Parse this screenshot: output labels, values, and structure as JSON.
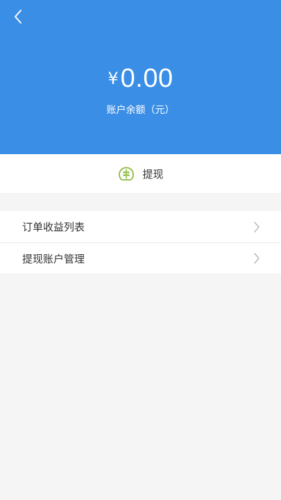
{
  "header": {
    "back_icon": "chevron-left-icon",
    "currency_symbol": "¥",
    "balance": "0.00",
    "balance_label": "账户余额（元）",
    "background_color": "#3a8ee6"
  },
  "withdraw": {
    "label": "提现",
    "icon": "wheat-coin-icon",
    "icon_color": "#8dbb3f"
  },
  "menu": {
    "items": [
      {
        "label": "订单收益列表",
        "icon": "chevron-right-icon"
      },
      {
        "label": "提现账户管理",
        "icon": "chevron-right-icon"
      }
    ]
  }
}
